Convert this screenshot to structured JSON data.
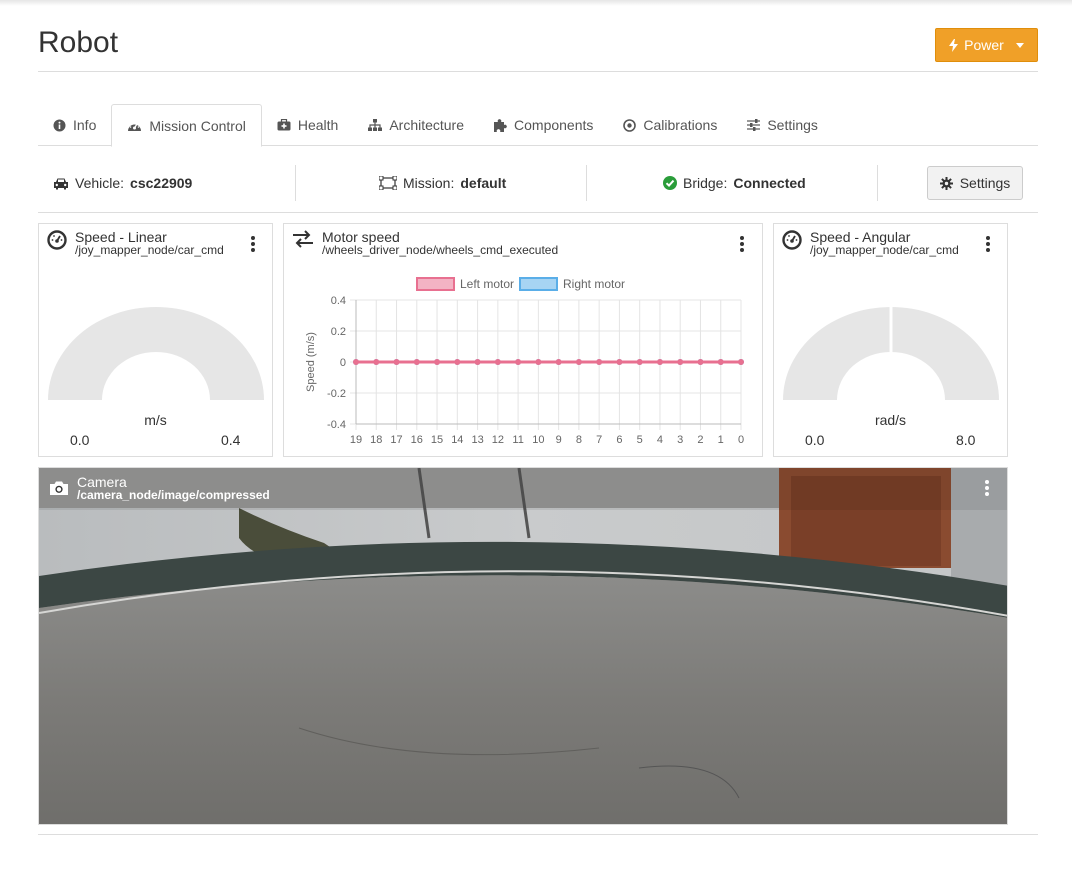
{
  "header": {
    "title": "Robot",
    "power_label": "Power",
    "power_color": "#f0a028"
  },
  "tabs": [
    {
      "label": "Info",
      "icon": "info-circle-icon",
      "active": false
    },
    {
      "label": "Mission Control",
      "icon": "dashboard-icon",
      "active": true
    },
    {
      "label": "Health",
      "icon": "medkit-icon",
      "active": false
    },
    {
      "label": "Architecture",
      "icon": "sitemap-icon",
      "active": false
    },
    {
      "label": "Components",
      "icon": "puzzle-icon",
      "active": false
    },
    {
      "label": "Calibrations",
      "icon": "dot-circle-icon",
      "active": false
    },
    {
      "label": "Settings",
      "icon": "sliders-icon",
      "active": false
    }
  ],
  "infobar": {
    "vehicle_label": "Vehicle:",
    "vehicle_value": "csc22909",
    "mission_label": "Mission:",
    "mission_value": "default",
    "bridge_label": "Bridge:",
    "bridge_value": "Connected",
    "bridge_status_color": "#2a9d3a",
    "settings_label": "Settings"
  },
  "speed_linear": {
    "title": "Speed - Linear",
    "topic": "/joy_mapper_node/car_cmd",
    "unit": "m/s",
    "min": "0.0",
    "max": "0.4",
    "value": 0
  },
  "speed_angular": {
    "title": "Speed - Angular",
    "topic": "/joy_mapper_node/car_cmd",
    "unit": "rad/s",
    "min": "0.0",
    "max": "8.0",
    "value": 0
  },
  "motor_speed": {
    "title": "Motor speed",
    "topic": "/wheels_driver_node/wheels_cmd_executed"
  },
  "chart_data": {
    "type": "line",
    "title": "",
    "xlabel": "",
    "ylabel": "Speed (m/s)",
    "x": [
      "19",
      "18",
      "17",
      "16",
      "15",
      "14",
      "13",
      "12",
      "11",
      "10",
      "9",
      "8",
      "7",
      "6",
      "5",
      "4",
      "3",
      "2",
      "1",
      "0"
    ],
    "yticks": [
      "0.4",
      "0.2",
      "0",
      "-0.2",
      "-0.4"
    ],
    "ylim": [
      -0.4,
      0.4
    ],
    "grid": true,
    "legend_position": "top",
    "series": [
      {
        "name": "Left motor",
        "color": "#e87090",
        "values": [
          0,
          0,
          0,
          0,
          0,
          0,
          0,
          0,
          0,
          0,
          0,
          0,
          0,
          0,
          0,
          0,
          0,
          0,
          0,
          0
        ]
      },
      {
        "name": "Right motor",
        "color": "#5aaee8",
        "values": [
          0,
          0,
          0,
          0,
          0,
          0,
          0,
          0,
          0,
          0,
          0,
          0,
          0,
          0,
          0,
          0,
          0,
          0,
          0,
          0
        ]
      }
    ]
  },
  "camera": {
    "title": "Camera",
    "topic": "/camera_node/image/compressed"
  }
}
